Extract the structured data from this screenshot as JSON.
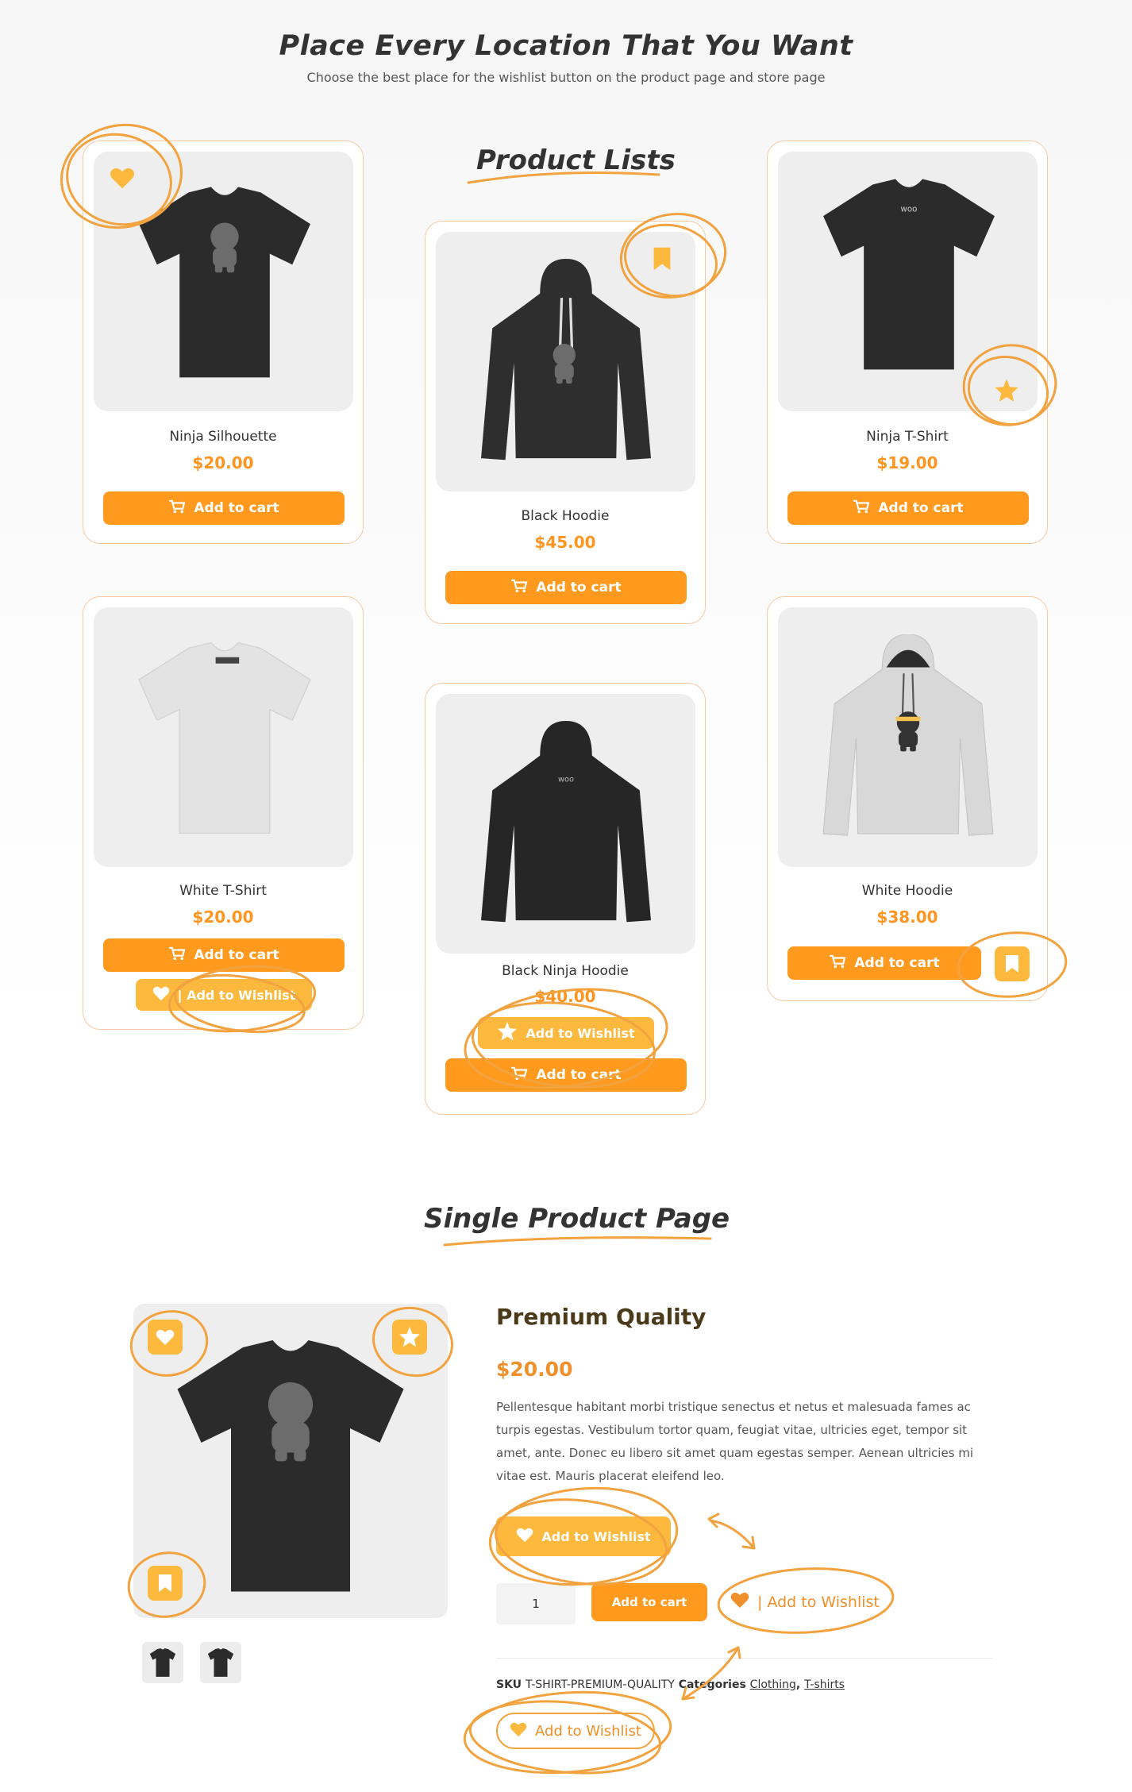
{
  "header": {
    "title": "Place Every Location That You Want",
    "subtitle": "Choose the best place for the wishlist button on the product page and store page"
  },
  "sections": {
    "product_lists": "Product Lists",
    "single_product": "Single Product Page"
  },
  "products": [
    {
      "name": "Ninja Silhouette",
      "price": "$20.00",
      "cart_label": "Add to cart",
      "wishlist_icon": "heart-icon"
    },
    {
      "name": "Black Hoodie",
      "price": "$45.00",
      "cart_label": "Add to cart",
      "wishlist_icon": "bookmark-icon"
    },
    {
      "name": "Ninja T-Shirt",
      "price": "$19.00",
      "cart_label": "Add to cart",
      "wishlist_icon": "star-icon"
    },
    {
      "name": "White T-Shirt",
      "price": "$20.00",
      "cart_label": "Add to cart",
      "wishlist_label": "|  Add to Wishlist",
      "wishlist_icon": "heart-icon"
    },
    {
      "name": "Black Ninja Hoodie",
      "price": "$40.00",
      "cart_label": "Add to cart",
      "wishlist_label": "Add to Wishlist",
      "wishlist_icon": "star-icon"
    },
    {
      "name": "White Hoodie",
      "price": "$38.00",
      "cart_label": "Add to cart",
      "wishlist_icon": "bookmark-icon"
    }
  ],
  "single": {
    "title": "Premium Quality",
    "price": "$20.00",
    "description": "Pellentesque habitant morbi tristique senectus et netus et malesuada fames ac turpis egestas. Vestibulum tortor quam, feugiat vitae, ultricies eget, tempor sit amet, ante. Donec eu libero sit amet quam egestas semper. Aenean ultricies mi vitae est. Mauris placerat eleifend leo.",
    "wishlist_primary": "Add to Wishlist",
    "quantity": "1",
    "cart_label": "Add to cart",
    "wishlist_inline": "|  Add to Wishlist",
    "sku_prefix": "SKU",
    "sku_value": "T-SHIRT-PREMIUM-QUALITY",
    "categories_label": "Categories",
    "categories": [
      "Clothing",
      "T-shirts"
    ],
    "wishlist_outline": "Add to Wishlist"
  },
  "colors": {
    "accent": "#ff9a1f",
    "wishlist": "#fdb93d",
    "scribble": "#f2a340",
    "card_border": "#f7c9a0"
  }
}
